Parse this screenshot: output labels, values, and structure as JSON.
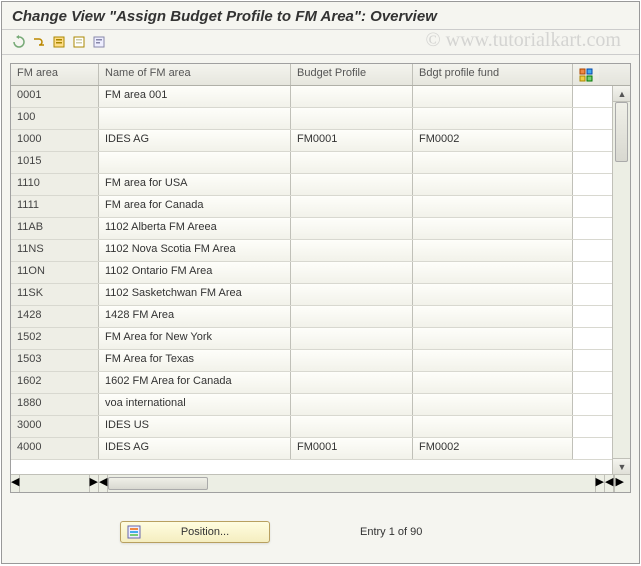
{
  "title": "Change View \"Assign Budget Profile to FM Area\": Overview",
  "watermark": "© www.tutorialkart.com",
  "toolbar": {
    "icons": [
      "undo",
      "toggle",
      "select-all",
      "deselect-all",
      "save-variant"
    ]
  },
  "table": {
    "headers": {
      "col0": "FM area",
      "col1": "Name of FM area",
      "col2": "Budget Profile",
      "col3": "Bdgt profile fund"
    },
    "rows": [
      {
        "c0": "0001",
        "c1": "FM area 001",
        "c2": "",
        "c3": ""
      },
      {
        "c0": "100",
        "c1": "",
        "c2": "",
        "c3": ""
      },
      {
        "c0": "1000",
        "c1": "IDES AG",
        "c2": "FM0001",
        "c3": "FM0002"
      },
      {
        "c0": "1015",
        "c1": "",
        "c2": "",
        "c3": ""
      },
      {
        "c0": "1110",
        "c1": "FM area for USA",
        "c2": "",
        "c3": ""
      },
      {
        "c0": "1111",
        "c1": "FM area for Canada",
        "c2": "",
        "c3": ""
      },
      {
        "c0": "11AB",
        "c1": "1102 Alberta FM Areea",
        "c2": "",
        "c3": ""
      },
      {
        "c0": "11NS",
        "c1": "1102 Nova Scotia FM Area",
        "c2": "",
        "c3": ""
      },
      {
        "c0": "11ON",
        "c1": "1102 Ontario FM Area",
        "c2": "",
        "c3": ""
      },
      {
        "c0": "11SK",
        "c1": "1102 Sasketchwan FM Area",
        "c2": "",
        "c3": ""
      },
      {
        "c0": "1428",
        "c1": "1428 FM Area",
        "c2": "",
        "c3": ""
      },
      {
        "c0": "1502",
        "c1": "FM Area for New York",
        "c2": "",
        "c3": ""
      },
      {
        "c0": "1503",
        "c1": "FM Area for Texas",
        "c2": "",
        "c3": ""
      },
      {
        "c0": "1602",
        "c1": "1602 FM Area for Canada",
        "c2": "",
        "c3": ""
      },
      {
        "c0": "1880",
        "c1": "voa international",
        "c2": "",
        "c3": ""
      },
      {
        "c0": "3000",
        "c1": "IDES US",
        "c2": "",
        "c3": ""
      },
      {
        "c0": "4000",
        "c1": "IDES AG",
        "c2": "FM0001",
        "c3": "FM0002"
      }
    ]
  },
  "footer": {
    "position_label": "Position...",
    "entry_text": "Entry 1 of 90"
  }
}
